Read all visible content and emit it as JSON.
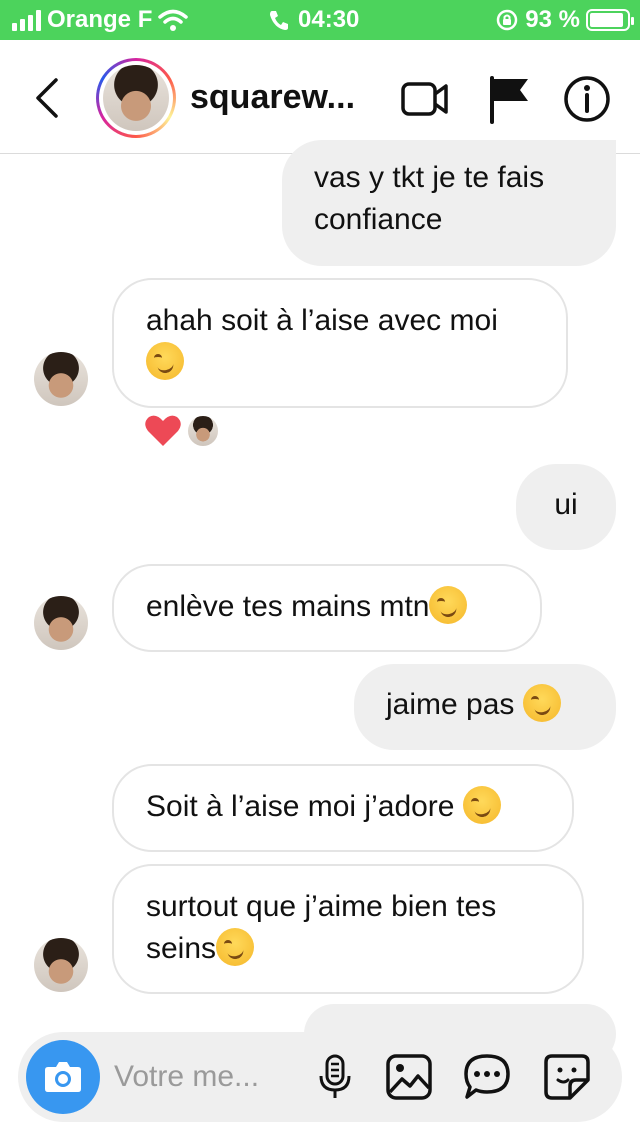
{
  "status_bar": {
    "carrier": "Orange F",
    "time": "04:30",
    "battery_percent": "93 %",
    "battery_level": 0.93
  },
  "header": {
    "username": "squarew...",
    "icons": [
      "back-icon",
      "video-camera-icon",
      "flag-icon",
      "info-icon"
    ]
  },
  "messages": [
    {
      "side": "out",
      "text": "vas y tkt je te fais confiance"
    },
    {
      "side": "in",
      "text": "ahah soit à l’aise avec moi",
      "emoji": "smirk-emoji",
      "reaction": "heart"
    },
    {
      "side": "out",
      "text": "ui"
    },
    {
      "side": "in",
      "text": "enlève tes mains mtn",
      "emoji": "smirk-emoji"
    },
    {
      "side": "out",
      "text": "jaime pas",
      "emoji": "smirk-emoji"
    },
    {
      "side": "in",
      "text": "Soit à l’aise moi j’adore",
      "emoji": "smirk-emoji"
    },
    {
      "side": "in",
      "text": "surtout que j’aime bien tes seins",
      "emoji": "smirk-emoji"
    }
  ],
  "composer": {
    "placeholder": "Votre me...",
    "icons": [
      "camera-icon",
      "microphone-icon",
      "gallery-icon",
      "chat-bubble-icon",
      "sticker-icon"
    ]
  },
  "colors": {
    "status_bar": "#4cd35c",
    "outgoing_bubble": "#efefef",
    "incoming_border": "#e4e4e4",
    "camera_button": "#3897f0",
    "heart": "#ed4956"
  }
}
